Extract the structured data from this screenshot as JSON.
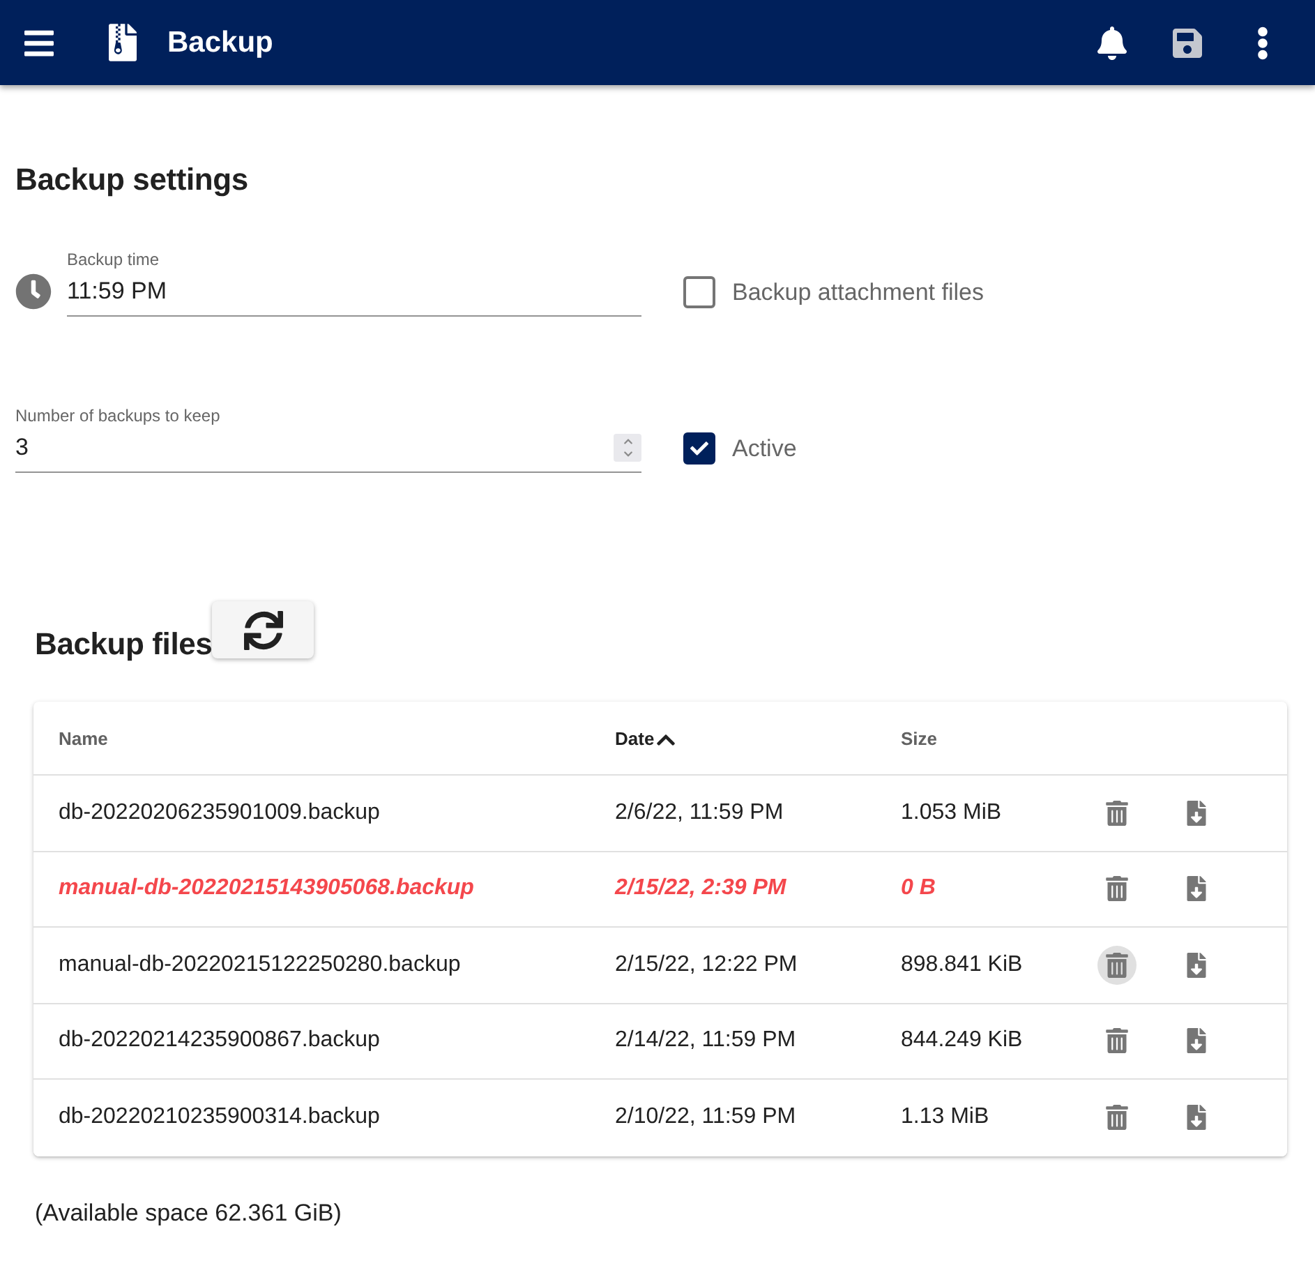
{
  "header": {
    "title": "Backup",
    "actions": [
      {
        "kind": "bell",
        "disabled": false
      },
      {
        "kind": "save",
        "disabled": true
      },
      {
        "kind": "more",
        "disabled": false
      }
    ]
  },
  "settings": {
    "title": "Backup settings",
    "fields": [
      {
        "kind": "time",
        "label": "Backup time",
        "value": "11:59 PM"
      },
      {
        "kind": "number",
        "label": "Number of backups to keep",
        "value": "3"
      }
    ],
    "checkboxes": [
      {
        "label": "Backup attachment files",
        "checked": false
      },
      {
        "label": "Active",
        "checked": true
      }
    ]
  },
  "files": {
    "title": "Backup files",
    "columns": [
      {
        "label": "Name",
        "sorted": false
      },
      {
        "label": "Date",
        "sorted": true
      },
      {
        "label": "Size",
        "sorted": false
      }
    ],
    "rows": [
      {
        "name": "db-20220206235901009.backup",
        "date": "2/6/22, 11:59 PM",
        "size": "1.053 MiB",
        "highlighted": false,
        "delete_hovered": false
      },
      {
        "name": "manual-db-20220215143905068.backup",
        "date": "2/15/22, 2:39 PM",
        "size": "0 B",
        "highlighted": true,
        "delete_hovered": false
      },
      {
        "name": "manual-db-20220215122250280.backup",
        "date": "2/15/22, 12:22 PM",
        "size": "898.841 KiB",
        "highlighted": false,
        "delete_hovered": true
      },
      {
        "name": "db-20220214235900867.backup",
        "date": "2/14/22, 11:59 PM",
        "size": "844.249 KiB",
        "highlighted": false,
        "delete_hovered": false
      },
      {
        "name": "db-20220210235900314.backup",
        "date": "2/10/22, 11:59 PM",
        "size": "1.13 MiB",
        "highlighted": false,
        "delete_hovered": false
      }
    ],
    "available_space": "(Available space 62.361 GiB)"
  }
}
